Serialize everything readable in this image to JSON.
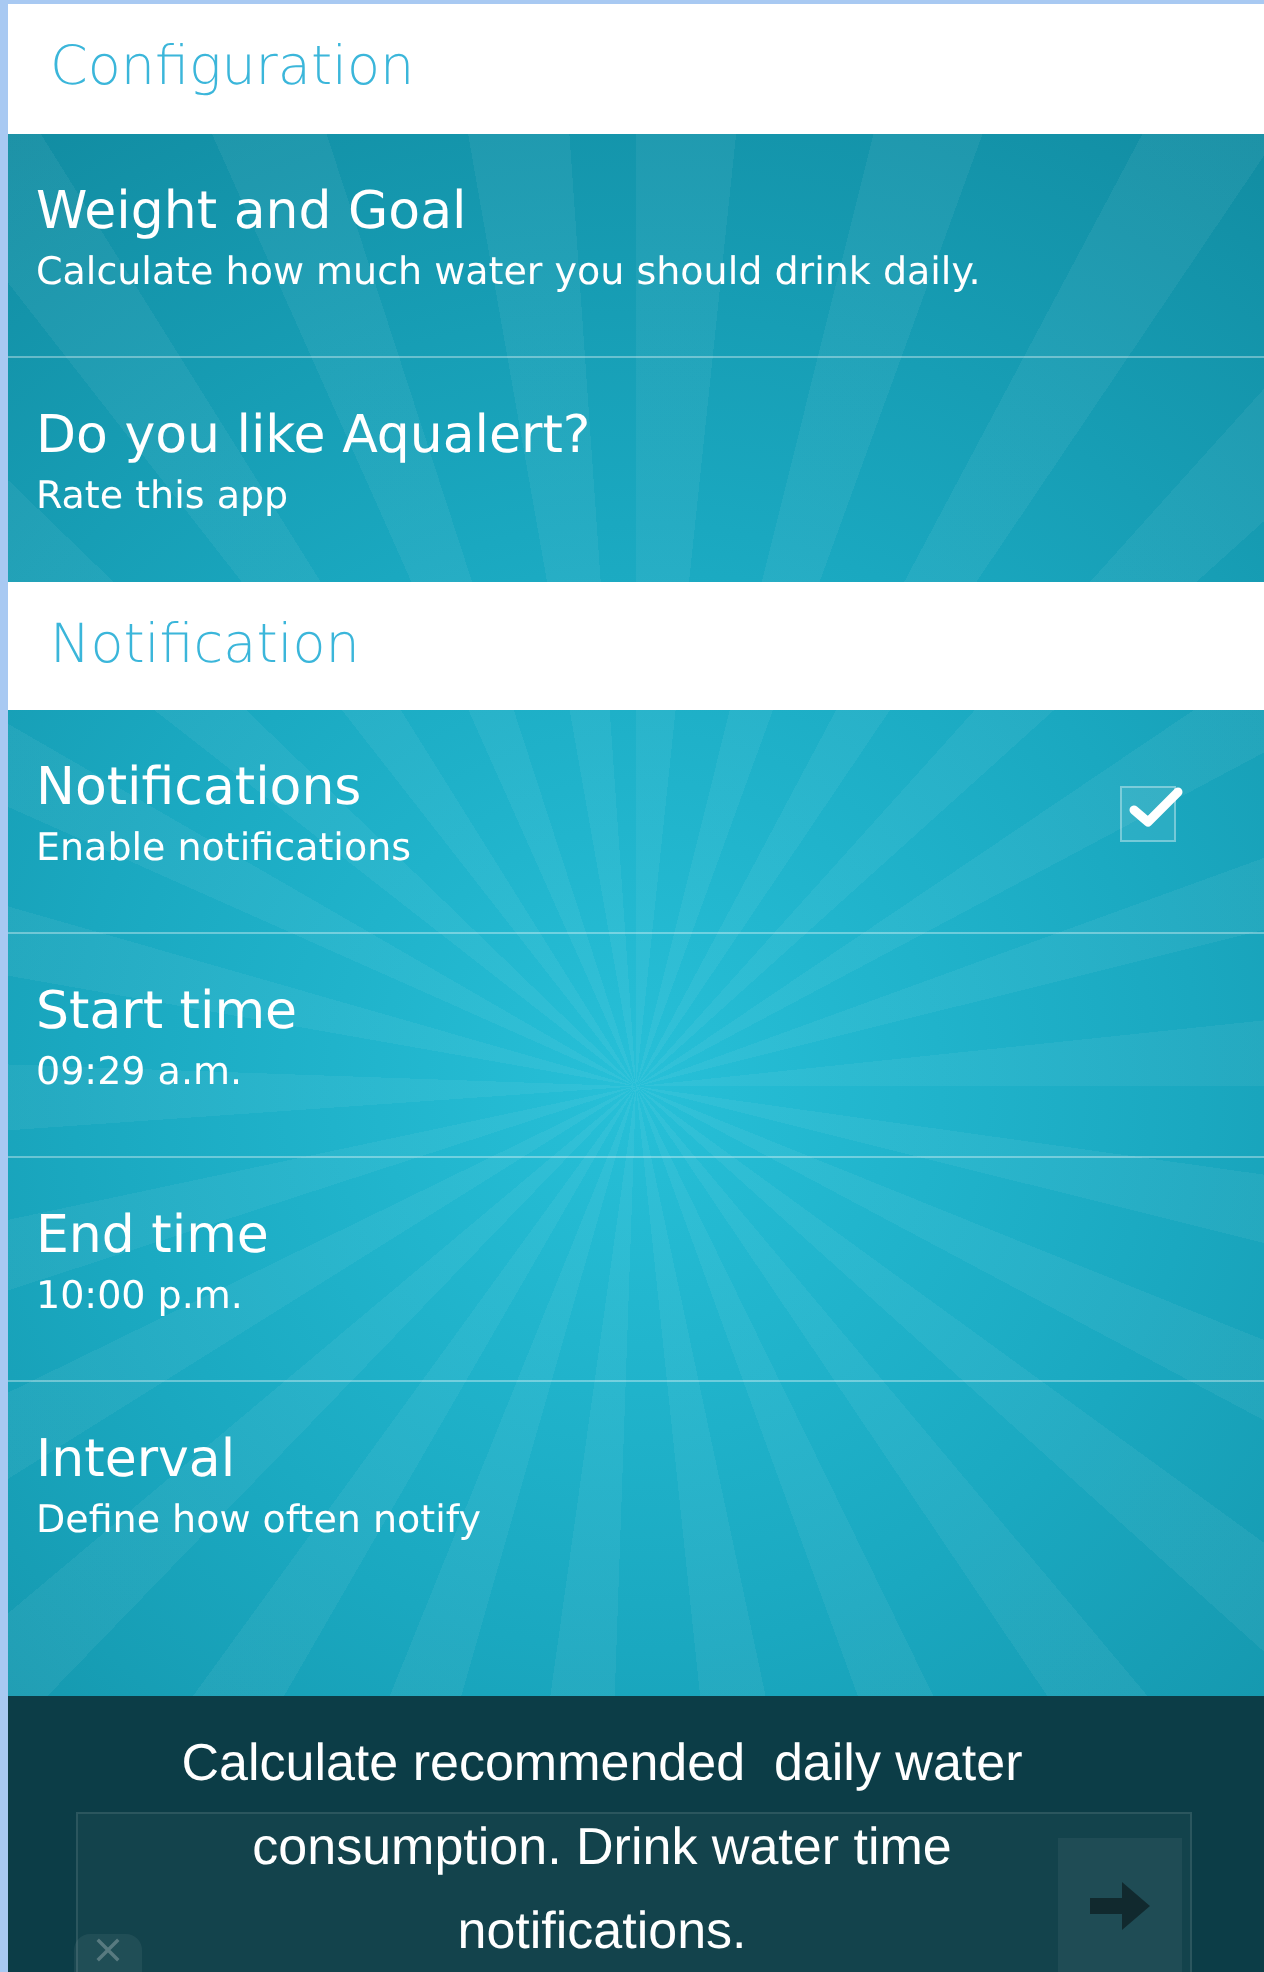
{
  "sections": [
    {
      "header": "Configuration",
      "items": [
        {
          "kind": "text",
          "title": "Weight and Goal",
          "subtitle": "Calculate how much water you should drink daily."
        },
        {
          "kind": "text",
          "title": "Do you like Aqualert?",
          "subtitle": "Rate this app"
        }
      ]
    },
    {
      "header": "Notification",
      "items": [
        {
          "kind": "checkbox",
          "title": "Notifications",
          "subtitle": "Enable notifications",
          "checked": true
        },
        {
          "kind": "text",
          "title": "Start time",
          "subtitle": "09:29 a.m."
        },
        {
          "kind": "text",
          "title": "End time",
          "subtitle": "10:00 p.m."
        },
        {
          "kind": "text",
          "title": "Interval",
          "subtitle": "Define how often notify"
        }
      ]
    }
  ],
  "caption": "Calculate recommended  daily water consumption. Drink water time notifications."
}
